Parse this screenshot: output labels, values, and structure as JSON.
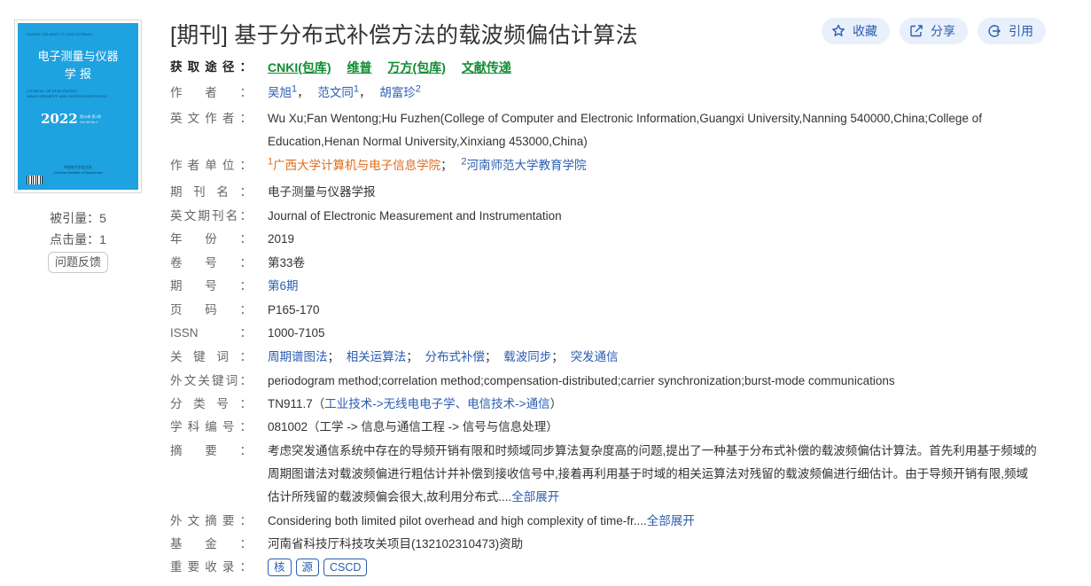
{
  "cover": {
    "title_line1": "电子测量与仪器",
    "title_line2": "学 报",
    "pinyin": "DIANZI CELIANG YU YIQI XUEBAO",
    "english1": "JOURNAL OF ELECTRONIC",
    "english2": "MEASUREMENT AND INSTRUMENTATION",
    "year": "2022",
    "vol": "第36卷 第1期",
    "vol_en": "Vol.36 No.1",
    "publisher": "中国电子学会主办",
    "publisher_en": "Chinese Institute of Electronics"
  },
  "stats": {
    "cited": "被引量：5",
    "clicks": "点击量：1",
    "feedback": "问题反馈"
  },
  "header": {
    "title": "[期刊] 基于分布式补偿方法的载波频偏估计算法"
  },
  "actions": {
    "collect": "收藏",
    "share": "分享",
    "cite": "引用"
  },
  "source": {
    "label": "获取途径：",
    "links": [
      "CNKI(包库)",
      "维普",
      "万方(包库)",
      "文献传递"
    ]
  },
  "labels": {
    "authors": "作者：",
    "en_authors": "英文作者：",
    "affiliation": "作者单位：",
    "journal": "期刊名：",
    "en_journal": "英文期刊名：",
    "year": "年份：",
    "volume": "卷号：",
    "issue": "期号：",
    "pages": "页码：",
    "issn": "ISSN：",
    "keywords": "关键词：",
    "en_keywords": "外文关键词：",
    "classification": "分类号：",
    "subject_code": "学科编号：",
    "abstract": "摘要：",
    "en_abstract": "外文摘要：",
    "fund": "基金：",
    "index": "重要收录："
  },
  "authors": [
    {
      "name": "吴旭",
      "sup": "1"
    },
    {
      "name": "范文同",
      "sup": "1"
    },
    {
      "name": "胡富珍",
      "sup": "2"
    }
  ],
  "en_authors": "Wu Xu;Fan Wentong;Hu Fuzhen(College of Computer and Electronic Information,Guangxi University,Nanning 540000,China;College of Education,Henan Normal University,Xinxiang 453000,China)",
  "affiliations": [
    {
      "sup": "1",
      "name": "广西大学计算机与电子信息学院"
    },
    {
      "sup": "2",
      "name": "河南师范大学教育学院"
    }
  ],
  "journal": "电子测量与仪器学报",
  "en_journal": "Journal of Electronic Measurement and Instrumentation",
  "year": "2019",
  "volume": "第33卷",
  "issue": "第6期",
  "pages": "P165-170",
  "issn": "1000-7105",
  "keywords": [
    "周期谱图法",
    "相关运算法",
    "分布式补偿",
    "载波同步",
    "突发通信"
  ],
  "en_keywords": "periodogram method;correlation method;compensation-distributed;carrier synchronization;burst-mode communications",
  "classification": {
    "code": "TN911.7",
    "open": "（",
    "path1": "工业技术",
    "arrow": "->",
    "path2": "无线电电子学、电信技术",
    "path3": "通信",
    "close": "）"
  },
  "subject": "081002（工学 -> 信息与通信工程 -> 信号与信息处理）",
  "abstract": {
    "text": "考虑突发通信系统中存在的导频开销有限和时频域同步算法复杂度高的问题,提出了一种基于分布式补偿的载波频偏估计算法。首先利用基于频域的周期图谱法对载波频偏进行粗估计并补偿到接收信号中,接着再利用基于时域的相关运算法对残留的载波频偏进行细估计。由于导频开销有限,频域估计所残留的载波频偏会很大,故利用分布式....",
    "expand": "全部展开"
  },
  "en_abstract": {
    "text": "Considering both limited pilot overhead and high complexity of time-fr....",
    "expand": "全部展开"
  },
  "fund": "河南省科技厅科技攻关项目(132102310473)资助",
  "index": [
    "核",
    "源",
    "CSCD"
  ],
  "colors": {
    "link_blue": "#2a5db0",
    "source_green": "#118c33",
    "affiliation_orange": "#e06c1a",
    "cover_blue": "#1fa2e0"
  }
}
